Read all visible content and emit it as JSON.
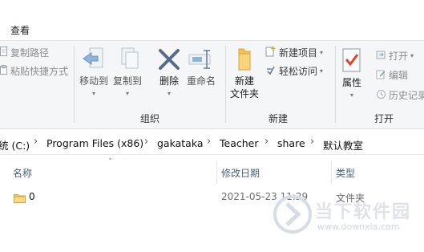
{
  "menu": {
    "view_tab": "查看"
  },
  "ribbon": {
    "clipboard": {
      "copy_path": "复制路径",
      "paste_shortcut": "粘贴快捷方式"
    },
    "organize": {
      "move_to": "移动到",
      "copy_to": "复制到",
      "delete": "删除",
      "rename": "重命名",
      "group_label": "组织"
    },
    "new": {
      "new_folder": "新建\n文件夹",
      "new_item": "新建项目",
      "easy_access": "轻松访问",
      "group_label": "新建"
    },
    "open": {
      "properties": "属性",
      "open": "打开",
      "edit": "编辑",
      "history": "历史记录",
      "group_label": "打开"
    }
  },
  "address_bar": {
    "crumbs": [
      "统 (C:)",
      "Program Files (x86)",
      "gakataka",
      "Teacher",
      "share",
      "默认教室"
    ]
  },
  "columns": {
    "name": "名称",
    "modified": "修改日期",
    "type": "类型"
  },
  "files": [
    {
      "name": "0",
      "modified": "2021-05-23 11:29",
      "type": "文件夹"
    }
  ],
  "watermark": {
    "title": "当下软件园",
    "url": "www.downxia.com"
  }
}
